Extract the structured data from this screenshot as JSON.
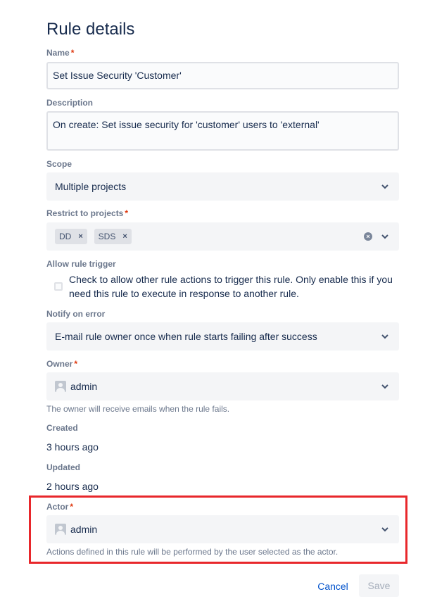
{
  "title": "Rule details",
  "name": {
    "label": "Name",
    "required": "*",
    "value": "Set Issue Security 'Customer'"
  },
  "description": {
    "label": "Description",
    "value": "On create: Set issue security for 'customer' users to 'external'"
  },
  "scope": {
    "label": "Scope",
    "value": "Multiple projects"
  },
  "restrict": {
    "label": "Restrict to projects",
    "required": "*",
    "tags": [
      "DD",
      "SDS"
    ],
    "tag_remove": "×",
    "clear": "×"
  },
  "allow_trigger": {
    "label": "Allow rule trigger",
    "text": "Check to allow other rule actions to trigger this rule. Only enable this if you need this rule to execute in response to another rule."
  },
  "notify": {
    "label": "Notify on error",
    "value": "E-mail rule owner once when rule starts failing after success"
  },
  "owner": {
    "label": "Owner",
    "required": "*",
    "value": "admin",
    "help": "The owner will receive emails when the rule fails."
  },
  "created": {
    "label": "Created",
    "value": "3 hours ago"
  },
  "updated": {
    "label": "Updated",
    "value": "2 hours ago"
  },
  "actor": {
    "label": "Actor",
    "required": "*",
    "value": "admin",
    "help": "Actions defined in this rule will be performed by the user selected as the actor."
  },
  "buttons": {
    "cancel": "Cancel",
    "save": "Save"
  },
  "colors": {
    "accent": "#0052cc",
    "required": "#de350b",
    "highlight": "#e8272b",
    "field_bg": "#f4f5f7"
  }
}
